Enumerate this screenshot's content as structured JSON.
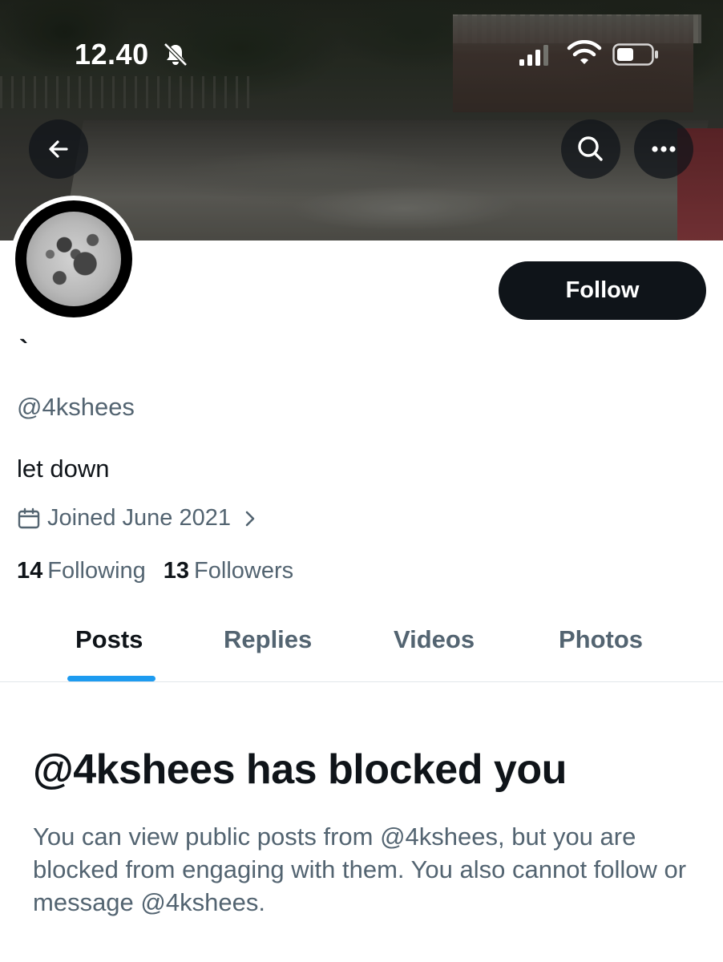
{
  "status_bar": {
    "time": "12.40",
    "icons": [
      "bell-slash-icon",
      "cellular-signal-icon",
      "wifi-icon",
      "battery-icon"
    ]
  },
  "nav": {
    "back_icon": "arrow-left-icon",
    "search_icon": "search-icon",
    "more_icon": "more-dots-icon"
  },
  "profile": {
    "display_name": "`",
    "handle": "@4kshees",
    "bio": "let down",
    "joined": "Joined June 2021",
    "following_count": "14",
    "following_label": "Following",
    "followers_count": "13",
    "followers_label": "Followers",
    "follow_button": "Follow"
  },
  "tabs": [
    {
      "label": "Posts",
      "active": true
    },
    {
      "label": "Replies",
      "active": false
    },
    {
      "label": "Videos",
      "active": false
    },
    {
      "label": "Photos",
      "active": false
    }
  ],
  "blocked": {
    "title": "@4kshees has blocked you",
    "description": "You can view public posts from @4kshees, but you are blocked from engaging with them. You also cannot follow or message @4kshees."
  },
  "colors": {
    "text_primary": "#0f1419",
    "text_secondary": "#536471",
    "accent": "#1d9bf0",
    "follow_bg": "#0f1419"
  }
}
